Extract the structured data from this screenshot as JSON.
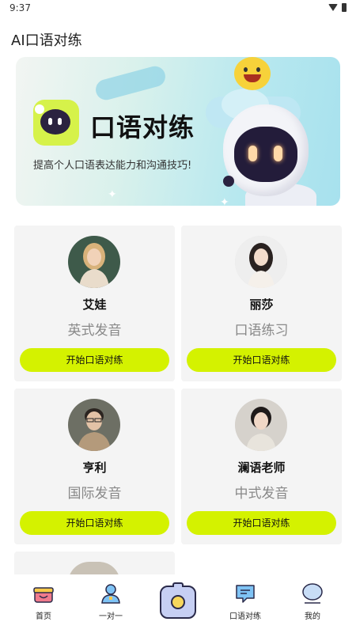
{
  "status_bar": {
    "time": "9:37"
  },
  "app": {
    "title": "AI口语对练"
  },
  "banner": {
    "title": "口语对练",
    "subtitle": "提高个人口语表达能力和沟通技巧!"
  },
  "tutors": [
    {
      "name": "艾娃",
      "desc": "英式发音",
      "button": "开始口语对练"
    },
    {
      "name": "丽莎",
      "desc": "口语练习",
      "button": "开始口语对练"
    },
    {
      "name": "亨利",
      "desc": "国际发音",
      "button": "开始口语对练"
    },
    {
      "name": "澜语老师",
      "desc": "中式发音",
      "button": "开始口语对练"
    }
  ],
  "bottom_nav": {
    "items": [
      {
        "label": "首页",
        "icon": "home-gift-icon"
      },
      {
        "label": "一对一",
        "icon": "person-icon"
      },
      {
        "label": "",
        "icon": "camera-icon"
      },
      {
        "label": "口语对练",
        "icon": "chat-bubble-icon"
      },
      {
        "label": "我的",
        "icon": "profile-icon"
      }
    ]
  },
  "colors": {
    "accent": "#d4f200",
    "card_bg": "#f4f4f4"
  }
}
